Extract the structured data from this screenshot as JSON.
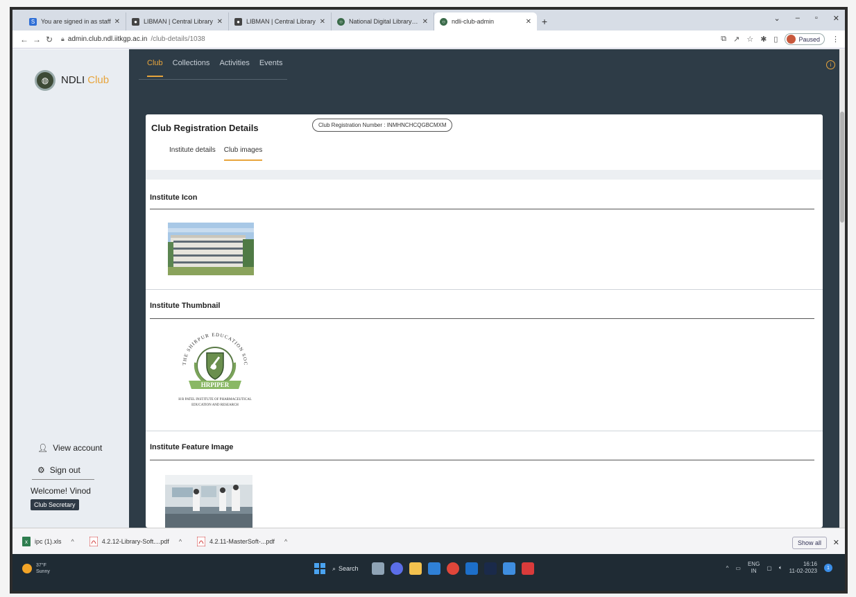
{
  "browser": {
    "tabs": [
      {
        "label": "You are signed in as staff",
        "favicon_color": "#2f6fd6",
        "active": false
      },
      {
        "label": "LIBMAN | Central Library",
        "favicon_color": "#444444",
        "active": false
      },
      {
        "label": "LIBMAN | Central Library",
        "favicon_color": "#444444",
        "active": false
      },
      {
        "label": "National Digital Library of India",
        "favicon_color": "#3b6b4a",
        "active": false
      },
      {
        "label": "ndli-club-admin",
        "favicon_color": "#3b6b4a",
        "active": true
      }
    ],
    "new_tab": "+",
    "url_host": "admin.club.ndl.iitkgp.ac.in",
    "url_path": "/club-details/1038",
    "profile_status": "Paused"
  },
  "app": {
    "logo_text": "NDLI",
    "logo_accent": "Club",
    "nav_tabs": [
      "Club",
      "Collections",
      "Activities",
      "Events"
    ],
    "selected_nav": "Club",
    "sidebar": {
      "view_account": "View account",
      "sign_out": "Sign out",
      "welcome": "Welcome! Vinod",
      "role": "Club Secretary"
    },
    "card": {
      "title": "Club Registration Details",
      "reg_badge": "Club Registration Number : INMHNCHCQGBCMXM",
      "subtabs": [
        "Institute details",
        "Club images"
      ],
      "selected_subtab": "Club images",
      "sections": [
        {
          "title": "Institute Icon"
        },
        {
          "title": "Institute Thumbnail"
        },
        {
          "title": "Institute Feature Image"
        }
      ],
      "thumbnail_logo": {
        "arc_text": "THE SHIRPUR EDUCATION SOCIETY",
        "ribbon_text": "HRPIPER",
        "caption_line1": "H R PATEL INSTITUTE OF PHARMACEUTICAL",
        "caption_line2": "EDUCATION AND RESEARCH"
      }
    }
  },
  "downloads": {
    "items": [
      {
        "label": "ipc (1).xls",
        "icon_color": "#2e7d4f"
      },
      {
        "label": "4.2.12-Library-Soft....pdf",
        "icon_color": "#d13b3b"
      },
      {
        "label": "4.2.11-MasterSoft-...pdf",
        "icon_color": "#d13b3b"
      }
    ],
    "show_all": "Show all"
  },
  "taskbar": {
    "weather_temp": "37°F",
    "weather_desc": "Sunny",
    "search_label": "Search",
    "lang_top": "ENG",
    "lang_bottom": "IN",
    "time": "16:16",
    "date": "11-02-2023",
    "notif_count": "1"
  },
  "colors": {
    "accent": "#e8a53c",
    "main_bg": "#2e3c47",
    "sidebar_bg": "#e9edf2"
  }
}
